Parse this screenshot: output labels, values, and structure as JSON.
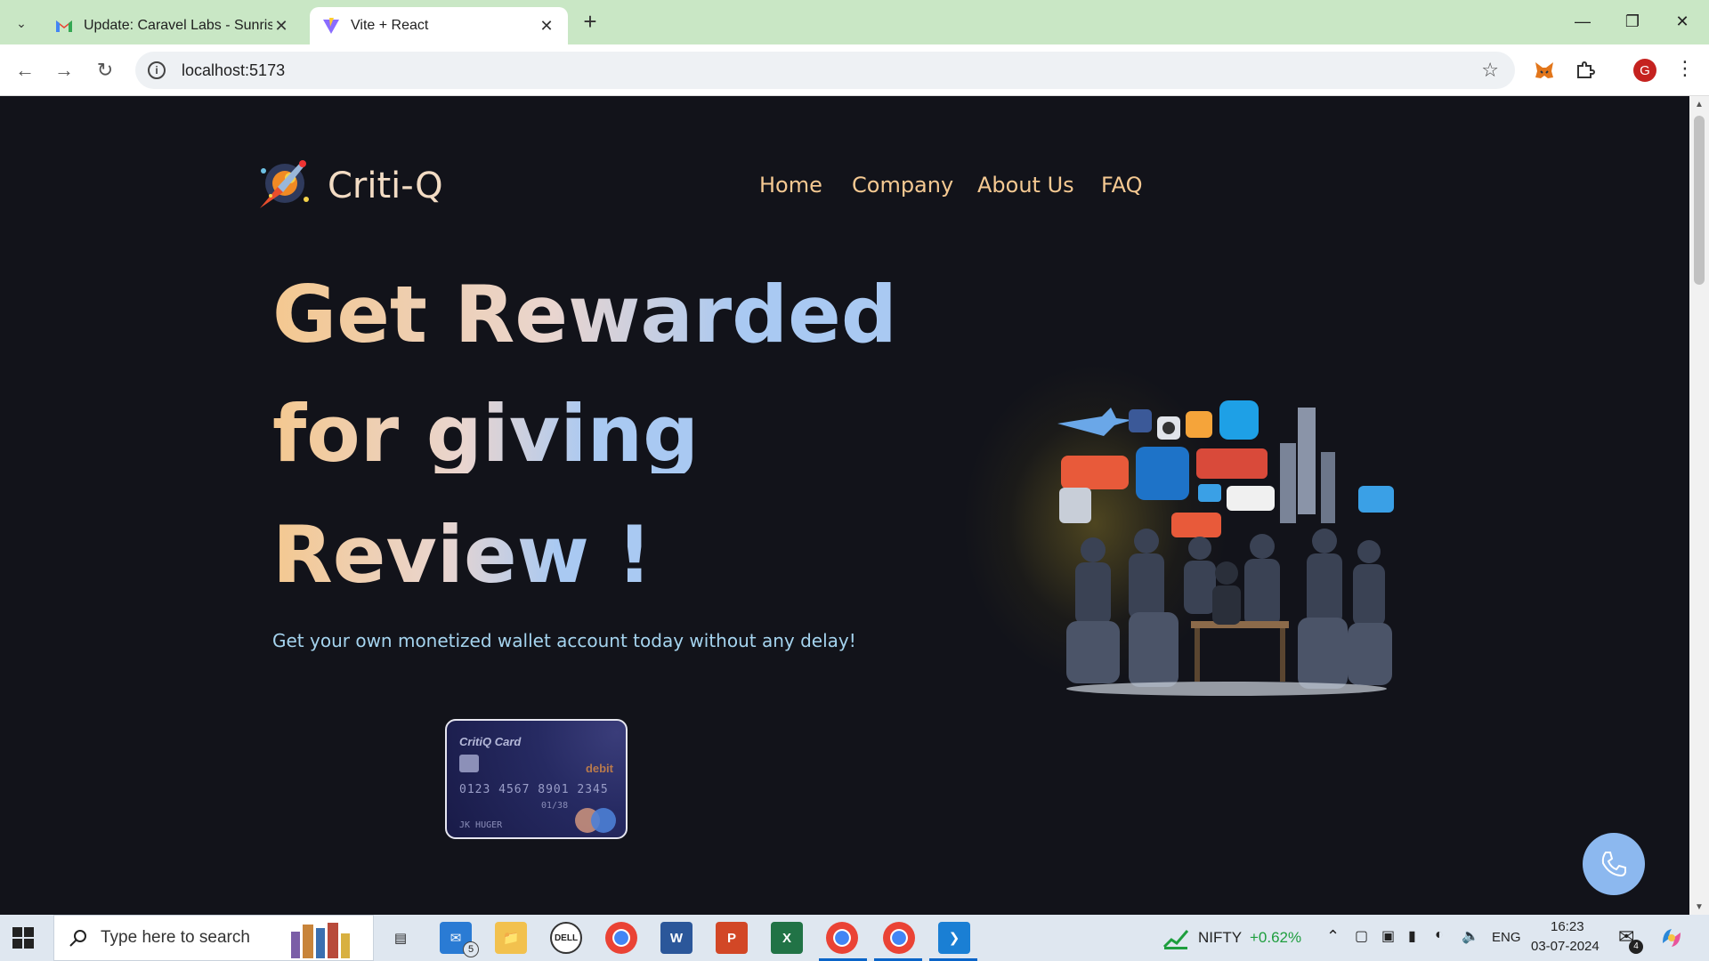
{
  "browser": {
    "tabs": [
      {
        "title": "Update: Caravel Labs - Sunrise",
        "active": false,
        "icon": "gmail-icon"
      },
      {
        "title": "Vite + React",
        "active": true,
        "icon": "vite-icon"
      }
    ],
    "url": "localhost:5173",
    "profile_initial": "G"
  },
  "site": {
    "brand": "Criti-Q",
    "nav": [
      "Home",
      "Company",
      "About Us",
      "FAQ"
    ],
    "hero_lines": [
      "Get Rewarded",
      "for giving",
      "Review !"
    ],
    "subtitle": "Get your own monetized wallet account today without any delay!",
    "card": {
      "title": "CritiQ Card",
      "type": "debit",
      "number": "0123  4567  8901  2345",
      "valid_thru": "01/38",
      "holder": "JK HUGER"
    },
    "colors": {
      "background": "#12131a",
      "nav": "#f5c992",
      "accent": "#8cb8ef"
    }
  },
  "taskbar": {
    "search_placeholder": "Type here to search",
    "mail_badge": "5",
    "market_name": "NIFTY",
    "market_change": "+0.62%",
    "language": "ENG",
    "time": "16:23",
    "date": "03-07-2024",
    "notification_count": "4"
  }
}
